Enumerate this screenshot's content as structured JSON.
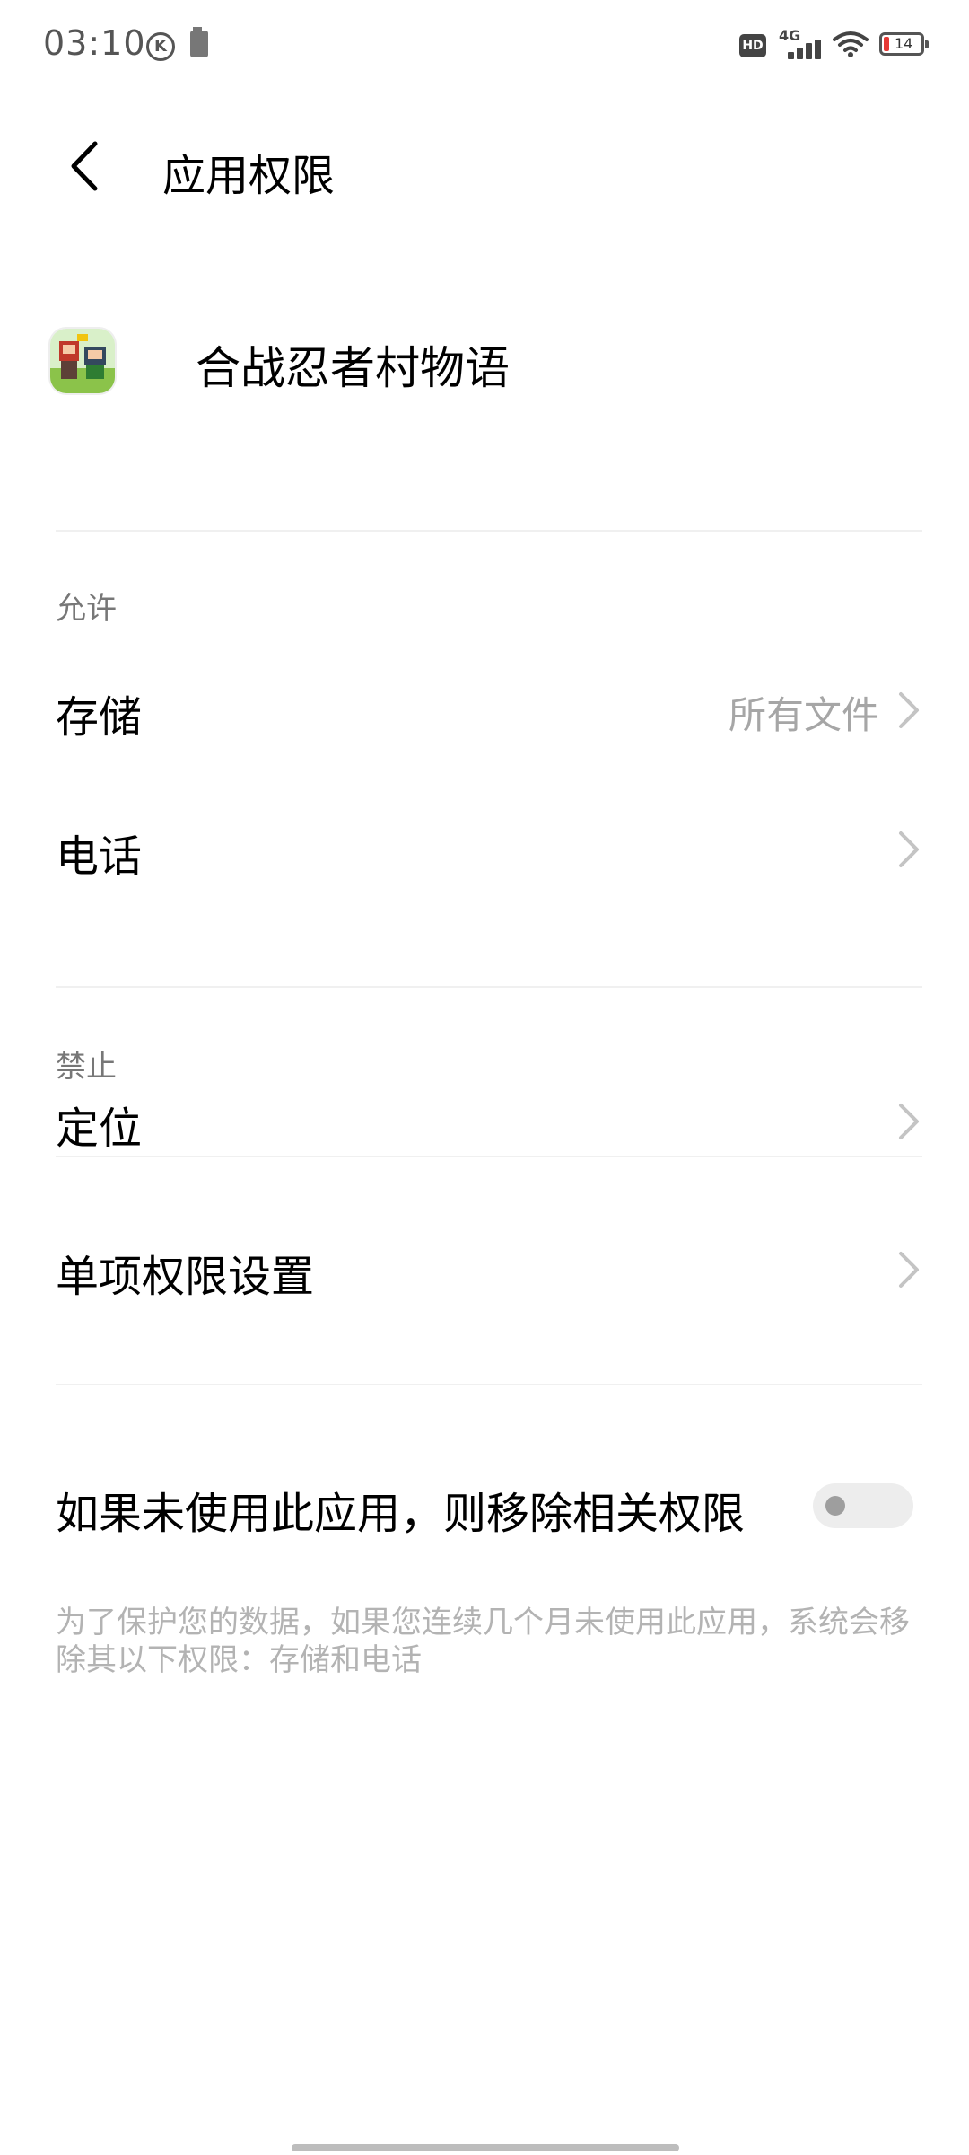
{
  "status_bar": {
    "time": "03:10",
    "network_label": "4G",
    "hd_label": "HD",
    "battery_level": "14",
    "icons": [
      "k-icon",
      "sim-icon",
      "hd-icon",
      "signal-icon",
      "wifi-icon",
      "battery-icon"
    ]
  },
  "header": {
    "title": "应用权限",
    "back_icon": "chevron-left-icon"
  },
  "app": {
    "name": "合战忍者村物语"
  },
  "sections": {
    "allowed_label": "允许",
    "denied_label": "禁止"
  },
  "permissions": {
    "storage": {
      "label": "存储",
      "value": "所有文件"
    },
    "phone": {
      "label": "电话"
    },
    "location": {
      "label": "定位"
    },
    "individual": {
      "label": "单项权限设置"
    }
  },
  "auto_revoke": {
    "label": "如果未使用此应用，则移除相关权限",
    "enabled": false,
    "note": "为了保护您的数据，如果您连续几个月未使用此应用，系统会移除其以下权限：存储和电话"
  },
  "colors": {
    "background": "#ffffff",
    "secondary_text": "#a6a6a6",
    "battery_low": "#e53935"
  }
}
